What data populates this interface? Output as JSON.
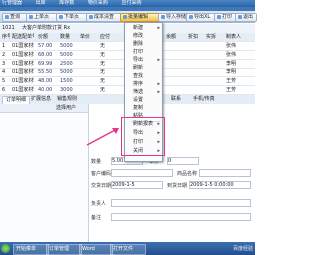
{
  "window": {
    "tabs": [
      "行管理器",
      "出库",
      "库存数",
      "物价采购",
      "应付采购"
    ]
  },
  "toolbar": {
    "buttons": [
      "查询",
      "上单页",
      "下单页",
      "成本清查",
      "批量编辑",
      "导入存储",
      "导出XL",
      "打印",
      "退出"
    ]
  },
  "info": {
    "ref": "1021",
    "text": "大客户单附款订货 Rx"
  },
  "table": {
    "headers": [
      "序号",
      "配送配单号",
      "价额",
      "数量",
      "单价",
      "应付",
      "余额",
      "折扣",
      "实拆",
      "制表人"
    ],
    "rows": [
      [
        "1",
        "01国家材料",
        "57.00",
        "5000",
        "",
        "无",
        "",
        "张伟"
      ],
      [
        "2",
        "01国家材料",
        "68.00",
        "5000",
        "",
        "无",
        "",
        "张伟"
      ],
      [
        "3",
        "01国家材料",
        "69.99",
        "2500",
        "",
        "无",
        "",
        "李明"
      ],
      [
        "4",
        "01国家材料",
        "55.50",
        "5000",
        "",
        "无",
        "",
        "李明"
      ],
      [
        "5",
        "01国家材料",
        "48.00",
        "1500",
        "",
        "无",
        "",
        "王芳"
      ],
      [
        "6",
        "01国家材料",
        "40.00",
        "3000",
        "",
        "无",
        "",
        "王芳"
      ]
    ]
  },
  "context_menu": {
    "items": [
      {
        "label": "新建",
        "sub": true
      },
      {
        "label": "修改",
        "sub": false
      },
      {
        "label": "删除",
        "sub": false
      },
      {
        "label": "打印",
        "sub": false
      },
      {
        "label": "导出",
        "sub": true
      },
      {
        "label": "刷新",
        "sub": false
      },
      {
        "label": "查找",
        "sub": false
      },
      {
        "label": "排序",
        "sub": true
      },
      {
        "label": "筛选",
        "sub": true
      },
      {
        "label": "设置",
        "sub": false
      },
      {
        "label": "复制",
        "sub": false
      },
      {
        "label": "粘贴",
        "sub": false
      }
    ],
    "highlighted_items": [
      {
        "label": "刷新报表",
        "sub": true
      },
      {
        "label": "导出",
        "sub": true
      },
      {
        "label": "打印",
        "sub": true
      },
      {
        "label": "关闭",
        "sub": true
      }
    ],
    "highlight_color": "#e2368c"
  },
  "bottom_tabs": [
    "订单明细",
    "扩展信息",
    "销售规则",
    "联系",
    "手机/传真"
  ],
  "left_pane": {
    "header": "选择用户"
  },
  "form": {
    "fields": [
      {
        "label": "数量",
        "value": "5.00"
      },
      {
        "label": "单价",
        "value": "0"
      },
      {
        "label": "客户编码",
        "value": ""
      },
      {
        "label": "商品名称",
        "value": ""
      },
      {
        "label": "交货日期",
        "value": "2009-1-5"
      },
      {
        "label": "到货日期",
        "value": "2009-1-5 0:00:00"
      },
      {
        "label": "负责人",
        "value": ""
      },
      {
        "label": "备注",
        "value": ""
      }
    ]
  },
  "taskbar": {
    "items": [
      "开始菜单",
      "订单管理",
      "Word",
      "打开文件"
    ],
    "watermark": "百度经验"
  },
  "colors": {
    "accent": "#2b64a6",
    "active_button": "#f2c04a",
    "highlight": "#e2368c"
  }
}
